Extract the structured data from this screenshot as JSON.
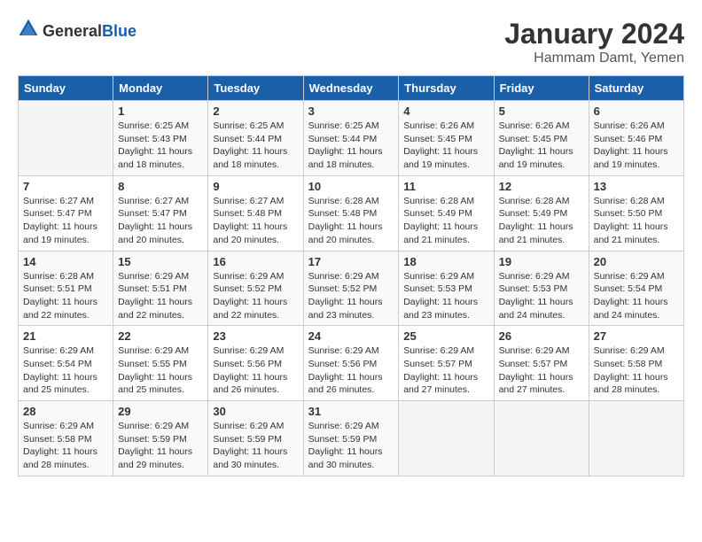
{
  "header": {
    "logo_general": "General",
    "logo_blue": "Blue",
    "title": "January 2024",
    "subtitle": "Hammam Damt, Yemen"
  },
  "columns": [
    "Sunday",
    "Monday",
    "Tuesday",
    "Wednesday",
    "Thursday",
    "Friday",
    "Saturday"
  ],
  "weeks": [
    [
      {
        "day": "",
        "sunrise": "",
        "sunset": "",
        "daylight": ""
      },
      {
        "day": "1",
        "sunrise": "Sunrise: 6:25 AM",
        "sunset": "Sunset: 5:43 PM",
        "daylight": "Daylight: 11 hours and 18 minutes."
      },
      {
        "day": "2",
        "sunrise": "Sunrise: 6:25 AM",
        "sunset": "Sunset: 5:44 PM",
        "daylight": "Daylight: 11 hours and 18 minutes."
      },
      {
        "day": "3",
        "sunrise": "Sunrise: 6:25 AM",
        "sunset": "Sunset: 5:44 PM",
        "daylight": "Daylight: 11 hours and 18 minutes."
      },
      {
        "day": "4",
        "sunrise": "Sunrise: 6:26 AM",
        "sunset": "Sunset: 5:45 PM",
        "daylight": "Daylight: 11 hours and 19 minutes."
      },
      {
        "day": "5",
        "sunrise": "Sunrise: 6:26 AM",
        "sunset": "Sunset: 5:45 PM",
        "daylight": "Daylight: 11 hours and 19 minutes."
      },
      {
        "day": "6",
        "sunrise": "Sunrise: 6:26 AM",
        "sunset": "Sunset: 5:46 PM",
        "daylight": "Daylight: 11 hours and 19 minutes."
      }
    ],
    [
      {
        "day": "7",
        "sunrise": "Sunrise: 6:27 AM",
        "sunset": "Sunset: 5:47 PM",
        "daylight": "Daylight: 11 hours and 19 minutes."
      },
      {
        "day": "8",
        "sunrise": "Sunrise: 6:27 AM",
        "sunset": "Sunset: 5:47 PM",
        "daylight": "Daylight: 11 hours and 20 minutes."
      },
      {
        "day": "9",
        "sunrise": "Sunrise: 6:27 AM",
        "sunset": "Sunset: 5:48 PM",
        "daylight": "Daylight: 11 hours and 20 minutes."
      },
      {
        "day": "10",
        "sunrise": "Sunrise: 6:28 AM",
        "sunset": "Sunset: 5:48 PM",
        "daylight": "Daylight: 11 hours and 20 minutes."
      },
      {
        "day": "11",
        "sunrise": "Sunrise: 6:28 AM",
        "sunset": "Sunset: 5:49 PM",
        "daylight": "Daylight: 11 hours and 21 minutes."
      },
      {
        "day": "12",
        "sunrise": "Sunrise: 6:28 AM",
        "sunset": "Sunset: 5:49 PM",
        "daylight": "Daylight: 11 hours and 21 minutes."
      },
      {
        "day": "13",
        "sunrise": "Sunrise: 6:28 AM",
        "sunset": "Sunset: 5:50 PM",
        "daylight": "Daylight: 11 hours and 21 minutes."
      }
    ],
    [
      {
        "day": "14",
        "sunrise": "Sunrise: 6:28 AM",
        "sunset": "Sunset: 5:51 PM",
        "daylight": "Daylight: 11 hours and 22 minutes."
      },
      {
        "day": "15",
        "sunrise": "Sunrise: 6:29 AM",
        "sunset": "Sunset: 5:51 PM",
        "daylight": "Daylight: 11 hours and 22 minutes."
      },
      {
        "day": "16",
        "sunrise": "Sunrise: 6:29 AM",
        "sunset": "Sunset: 5:52 PM",
        "daylight": "Daylight: 11 hours and 22 minutes."
      },
      {
        "day": "17",
        "sunrise": "Sunrise: 6:29 AM",
        "sunset": "Sunset: 5:52 PM",
        "daylight": "Daylight: 11 hours and 23 minutes."
      },
      {
        "day": "18",
        "sunrise": "Sunrise: 6:29 AM",
        "sunset": "Sunset: 5:53 PM",
        "daylight": "Daylight: 11 hours and 23 minutes."
      },
      {
        "day": "19",
        "sunrise": "Sunrise: 6:29 AM",
        "sunset": "Sunset: 5:53 PM",
        "daylight": "Daylight: 11 hours and 24 minutes."
      },
      {
        "day": "20",
        "sunrise": "Sunrise: 6:29 AM",
        "sunset": "Sunset: 5:54 PM",
        "daylight": "Daylight: 11 hours and 24 minutes."
      }
    ],
    [
      {
        "day": "21",
        "sunrise": "Sunrise: 6:29 AM",
        "sunset": "Sunset: 5:54 PM",
        "daylight": "Daylight: 11 hours and 25 minutes."
      },
      {
        "day": "22",
        "sunrise": "Sunrise: 6:29 AM",
        "sunset": "Sunset: 5:55 PM",
        "daylight": "Daylight: 11 hours and 25 minutes."
      },
      {
        "day": "23",
        "sunrise": "Sunrise: 6:29 AM",
        "sunset": "Sunset: 5:56 PM",
        "daylight": "Daylight: 11 hours and 26 minutes."
      },
      {
        "day": "24",
        "sunrise": "Sunrise: 6:29 AM",
        "sunset": "Sunset: 5:56 PM",
        "daylight": "Daylight: 11 hours and 26 minutes."
      },
      {
        "day": "25",
        "sunrise": "Sunrise: 6:29 AM",
        "sunset": "Sunset: 5:57 PM",
        "daylight": "Daylight: 11 hours and 27 minutes."
      },
      {
        "day": "26",
        "sunrise": "Sunrise: 6:29 AM",
        "sunset": "Sunset: 5:57 PM",
        "daylight": "Daylight: 11 hours and 27 minutes."
      },
      {
        "day": "27",
        "sunrise": "Sunrise: 6:29 AM",
        "sunset": "Sunset: 5:58 PM",
        "daylight": "Daylight: 11 hours and 28 minutes."
      }
    ],
    [
      {
        "day": "28",
        "sunrise": "Sunrise: 6:29 AM",
        "sunset": "Sunset: 5:58 PM",
        "daylight": "Daylight: 11 hours and 28 minutes."
      },
      {
        "day": "29",
        "sunrise": "Sunrise: 6:29 AM",
        "sunset": "Sunset: 5:59 PM",
        "daylight": "Daylight: 11 hours and 29 minutes."
      },
      {
        "day": "30",
        "sunrise": "Sunrise: 6:29 AM",
        "sunset": "Sunset: 5:59 PM",
        "daylight": "Daylight: 11 hours and 30 minutes."
      },
      {
        "day": "31",
        "sunrise": "Sunrise: 6:29 AM",
        "sunset": "Sunset: 5:59 PM",
        "daylight": "Daylight: 11 hours and 30 minutes."
      },
      {
        "day": "",
        "sunrise": "",
        "sunset": "",
        "daylight": ""
      },
      {
        "day": "",
        "sunrise": "",
        "sunset": "",
        "daylight": ""
      },
      {
        "day": "",
        "sunrise": "",
        "sunset": "",
        "daylight": ""
      }
    ]
  ]
}
